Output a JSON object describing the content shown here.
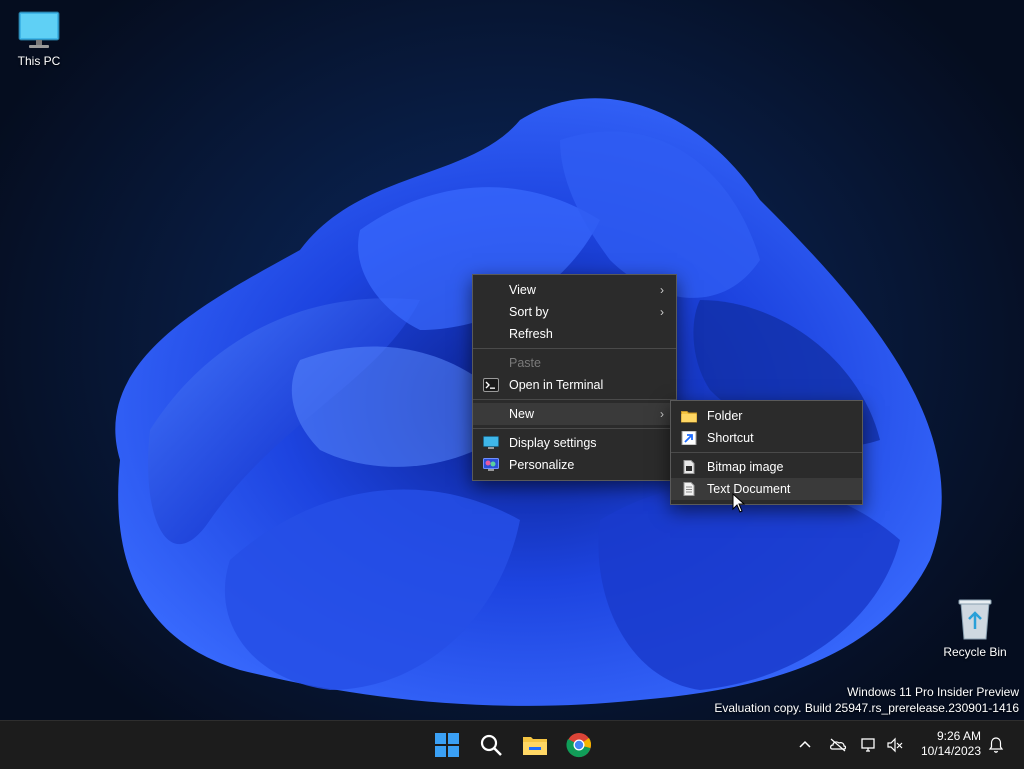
{
  "desktop": {
    "icons": [
      {
        "label": "This PC",
        "icon": "monitor-icon"
      },
      {
        "label": "Recycle Bin",
        "icon": "recycle-bin-icon"
      }
    ]
  },
  "context_menu": {
    "items": [
      {
        "label": "View",
        "submenu": true
      },
      {
        "label": "Sort by",
        "submenu": true
      },
      {
        "label": "Refresh"
      },
      {
        "label": "Paste",
        "disabled": true
      },
      {
        "label": "Open in Terminal",
        "icon": "terminal-icon"
      },
      {
        "label": "New",
        "submenu": true,
        "highlighted": true
      },
      {
        "label": "Display settings",
        "icon": "display-icon"
      },
      {
        "label": "Personalize",
        "icon": "personalize-icon"
      }
    ]
  },
  "new_submenu": {
    "items": [
      {
        "label": "Folder",
        "icon": "folder-icon"
      },
      {
        "label": "Shortcut",
        "icon": "shortcut-icon"
      },
      {
        "label": "Bitmap image",
        "icon": "bitmap-icon"
      },
      {
        "label": "Text Document",
        "icon": "text-document-icon",
        "hovered": true
      }
    ]
  },
  "watermark": {
    "line1": "Windows 11 Pro Insider Preview",
    "line2": "Evaluation copy. Build 25947.rs_prerelease.230901-1416"
  },
  "taskbar": {
    "apps": [
      "start-icon",
      "search-icon",
      "file-explorer-icon",
      "chrome-icon"
    ],
    "time": "9:26 AM",
    "date": "10/14/2023"
  },
  "colors": {
    "menu_bg": "#2b2b2b",
    "taskbar_bg": "#1c1c1c",
    "accent": "#1e6cff"
  }
}
